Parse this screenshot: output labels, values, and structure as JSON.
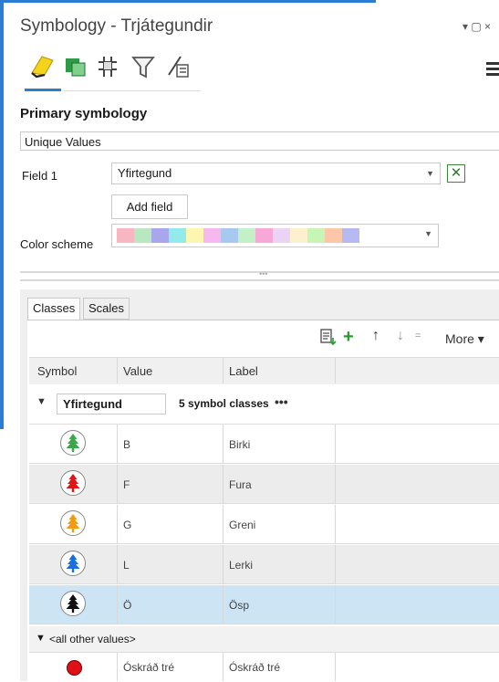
{
  "pane": {
    "title": "Symbology - Trjátegundir",
    "window_controls": "▾ ▢ ×"
  },
  "tabs": [
    "primary-symbology",
    "vary-symbology",
    "symbol-layer-drawing",
    "feature-filter",
    "label-classes"
  ],
  "primary": {
    "heading": "Primary symbology",
    "renderer": "Unique Values",
    "field1_label": "Field 1",
    "field1_value": "Yfirtegund",
    "add_field_label": "Add field",
    "color_scheme_label": "Color scheme",
    "color_ramp": [
      "#f7b6c2",
      "#b9e8c0",
      "#a9a6ee",
      "#93eaea",
      "#fdf6b0",
      "#f6b8ef",
      "#a7c9f0",
      "#c4f0c8",
      "#f7a8d6",
      "#ebd3f6",
      "#fdf0cf",
      "#c6f5b6",
      "#fbc7a8",
      "#b6b9f2"
    ]
  },
  "subtabs": {
    "classes": "Classes",
    "scales": "Scales"
  },
  "toolbar": {
    "add_icon": "+",
    "up_icon": "↑",
    "down_icon": "↓",
    "sort_icon": "=",
    "more_label": "More ▾"
  },
  "grid": {
    "headers": [
      "Symbol",
      "Value",
      "Label"
    ],
    "group_field": "Yfirtegund",
    "group_count": "5 symbol classes",
    "group_more": "•••",
    "rows": [
      {
        "value": "B",
        "label": "Birki",
        "color": "#3aa84a",
        "bg": "#ffffff"
      },
      {
        "value": "F",
        "label": "Fura",
        "color": "#e01515",
        "bg": "#ececec"
      },
      {
        "value": "G",
        "label": "Greni",
        "color": "#f29a10",
        "bg": "#ffffff"
      },
      {
        "value": "L",
        "label": "Lerki",
        "color": "#1a6ee0",
        "bg": "#ececec"
      },
      {
        "value": "Ö",
        "label": "Ösp",
        "color": "#111111",
        "bg": "#cde4f5"
      }
    ],
    "other_label": "<all other values>",
    "unclassified_value": "Óskráð tré",
    "unclassified_label": "Óskráð tré"
  }
}
